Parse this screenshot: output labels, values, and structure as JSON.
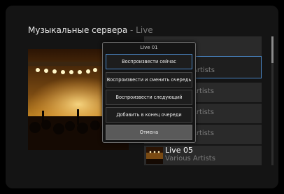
{
  "header": {
    "title": "Музыкальные сервера",
    "separator": " - ",
    "subtitle": "Live"
  },
  "list": {
    "items": [
      {
        "name": "",
        "artist": "",
        "focused": false
      },
      {
        "name": "",
        "artist": "Artists",
        "focused": true
      },
      {
        "name": "",
        "artist": "Artists",
        "focused": false
      },
      {
        "name": "",
        "artist": "Artists",
        "focused": false
      },
      {
        "name": "",
        "artist": "Artists",
        "focused": false
      },
      {
        "name": "Live 05",
        "artist": "Various Artists",
        "focused": false
      }
    ]
  },
  "popup": {
    "title": "Live 01",
    "options": [
      "Воспроизвести сейчас",
      "Воспроизвести и сменить очередь",
      "Воспроизвести следующий",
      "Добавить в конец очереди",
      "Отмена"
    ]
  },
  "colors": {
    "accent": "#4a86c5",
    "background": "#000000",
    "panel": "#141414"
  },
  "icons": {
    "album_art": "concert-stage-image"
  }
}
